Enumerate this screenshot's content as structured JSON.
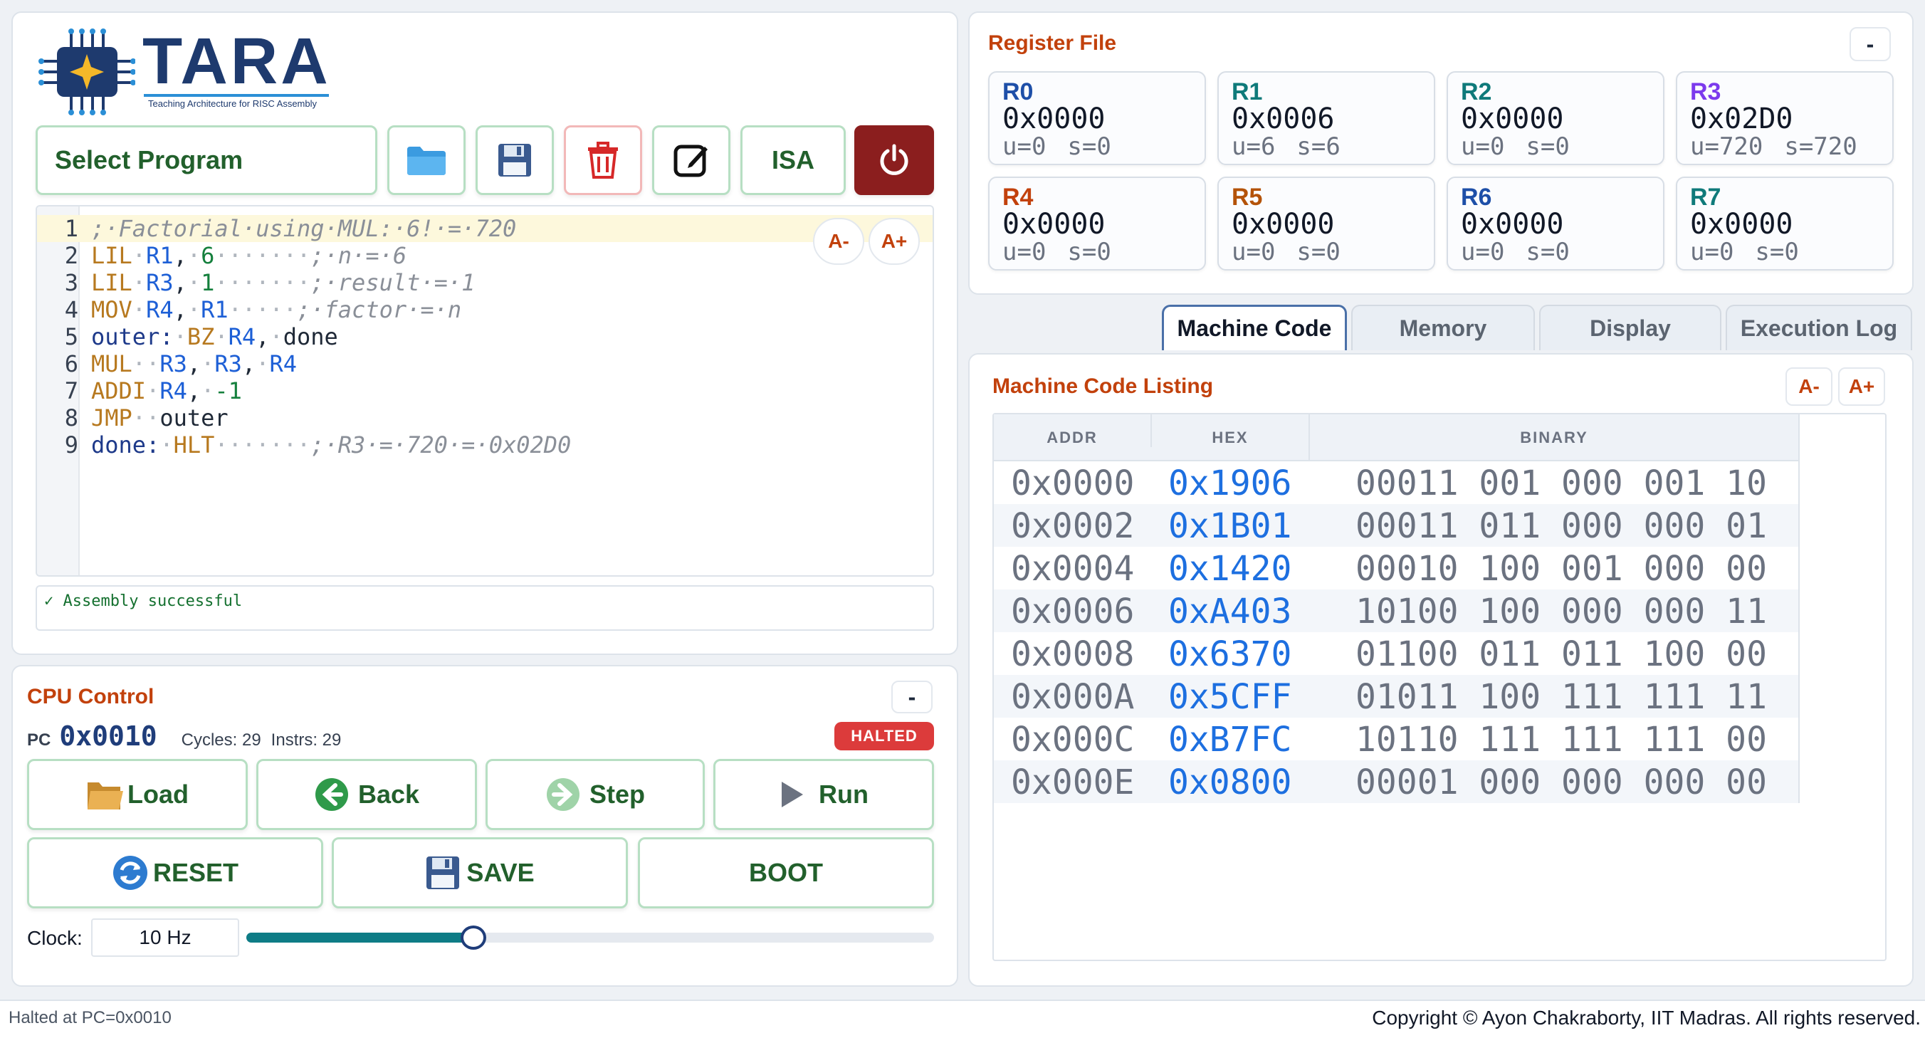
{
  "logo": {
    "name": "TARA",
    "tagline": "Teaching Architecture for RISC Assembly"
  },
  "toolbar": {
    "select_program": "Select Program",
    "isa": "ISA",
    "icons": [
      "folder-icon",
      "save-icon",
      "trash-icon",
      "edit-icon",
      "power-icon"
    ]
  },
  "editor": {
    "lines": [
      {
        "n": "1",
        "text": ";·Factorial·using·MUL:·6!·=·720"
      },
      {
        "n": "2",
        "text": "LIL·R1,·6·······;·n·=·6"
      },
      {
        "n": "3",
        "text": "LIL·R3,·1·······;·result·=·1"
      },
      {
        "n": "4",
        "text": "MOV·R4,·R1·····;·factor·=·n"
      },
      {
        "n": "5",
        "text": "outer:·BZ·R4,·done"
      },
      {
        "n": "6",
        "text": "MUL··R3,·R3,·R4"
      },
      {
        "n": "7",
        "text": "ADDI·R4,·-1"
      },
      {
        "n": "8",
        "text": "JMP··outer"
      },
      {
        "n": "9",
        "text": "done:·HLT·······;·R3·=·720·=·0x02D0"
      }
    ],
    "font_minus": "A-",
    "font_plus": "A+",
    "status": "✓ Assembly successful"
  },
  "cpu": {
    "title": "CPU Control",
    "collapse": "-",
    "pc_label": "PC",
    "pc_value": "0x0010",
    "cycles": "Cycles: 29",
    "instrs": "Instrs: 29",
    "state": "HALTED",
    "buttons": {
      "load": "Load",
      "back": "Back",
      "step": "Step",
      "run": "Run",
      "reset": "RESET",
      "save": "SAVE",
      "boot": "BOOT"
    },
    "clock_label": "Clock:",
    "clock_value": "10 Hz",
    "clock_slider_fraction": 0.33
  },
  "registers": {
    "title": "Register File",
    "collapse": "-",
    "items": [
      {
        "name": "R0",
        "hex": "0x0000",
        "u": "u=0",
        "s": "s=0",
        "color": "#1e4fa8"
      },
      {
        "name": "R1",
        "hex": "0x0006",
        "u": "u=6",
        "s": "s=6",
        "color": "#0f7a7a"
      },
      {
        "name": "R2",
        "hex": "0x0000",
        "u": "u=0",
        "s": "s=0",
        "color": "#0f7a7a"
      },
      {
        "name": "R3",
        "hex": "0x02D0",
        "u": "u=720",
        "s": "s=720",
        "color": "#7c3aed"
      },
      {
        "name": "R4",
        "hex": "0x0000",
        "u": "u=0",
        "s": "s=0",
        "color": "#c2410c"
      },
      {
        "name": "R5",
        "hex": "0x0000",
        "u": "u=0",
        "s": "s=0",
        "color": "#b45309"
      },
      {
        "name": "R6",
        "hex": "0x0000",
        "u": "u=0",
        "s": "s=0",
        "color": "#1e4fa8"
      },
      {
        "name": "R7",
        "hex": "0x0000",
        "u": "u=0",
        "s": "s=0",
        "color": "#0f7a7a"
      }
    ]
  },
  "tabs": [
    {
      "label": "Machine Code",
      "active": true
    },
    {
      "label": "Memory"
    },
    {
      "label": "Display"
    },
    {
      "label": "Execution Log"
    }
  ],
  "listing": {
    "title": "Machine Code Listing",
    "font_minus": "A-",
    "font_plus": "A+",
    "headers": [
      "ADDR",
      "HEX",
      "BINARY"
    ],
    "rows": [
      {
        "addr": "0x0000",
        "hex": "0x1906",
        "bin": "00011 001 000 001 10"
      },
      {
        "addr": "0x0002",
        "hex": "0x1B01",
        "bin": "00011 011 000 000 01"
      },
      {
        "addr": "0x0004",
        "hex": "0x1420",
        "bin": "00010 100 001 000 00"
      },
      {
        "addr": "0x0006",
        "hex": "0xA403",
        "bin": "10100 100 000 000 11"
      },
      {
        "addr": "0x0008",
        "hex": "0x6370",
        "bin": "01100 011 011 100 00"
      },
      {
        "addr": "0x000A",
        "hex": "0x5CFF",
        "bin": "01011 100 111 111 11"
      },
      {
        "addr": "0x000C",
        "hex": "0xB7FC",
        "bin": "10110 111 111 111 00"
      },
      {
        "addr": "0x000E",
        "hex": "0x0800",
        "bin": "00001 000 000 000 00"
      }
    ]
  },
  "footer": {
    "status": "Halted at PC=0x0010",
    "copyright": "Copyright © Ayon Chakraborty, IIT Madras. All rights reserved."
  },
  "colors": {
    "accent": "#c2410c",
    "button_border": "#b7dfc3",
    "halted": "#dc3b3b",
    "power": "#8b1e1e",
    "slider": "#0e7c86"
  }
}
